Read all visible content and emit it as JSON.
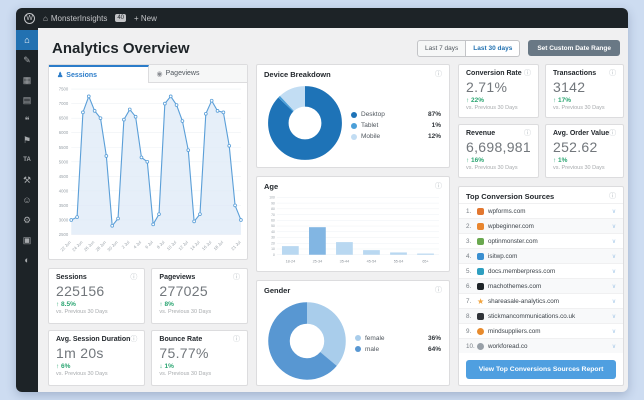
{
  "admin_bar": {
    "wp_logo": "W",
    "home_icon": "⌂",
    "site_name": "MonsterInsights",
    "comment_count": "40",
    "new_label": "+ New"
  },
  "sidebar": {
    "items": [
      {
        "name": "dashboard",
        "glyph": "⌂",
        "active": true
      },
      {
        "name": "posts-pin",
        "glyph": "✎",
        "active": false
      },
      {
        "name": "media",
        "glyph": "▦",
        "active": false
      },
      {
        "name": "pages",
        "glyph": "▤",
        "active": false
      },
      {
        "name": "comments",
        "glyph": "❝",
        "active": false
      },
      {
        "name": "feedback-flag",
        "glyph": "⚑",
        "active": false
      },
      {
        "name": "ta-plugin",
        "glyph": "TA",
        "active": false
      },
      {
        "name": "plugins",
        "glyph": "⚒",
        "active": false
      },
      {
        "name": "users",
        "glyph": "☺",
        "active": false
      },
      {
        "name": "tools",
        "glyph": "⚙",
        "active": false
      },
      {
        "name": "media-2",
        "glyph": "▣",
        "active": false
      },
      {
        "name": "settings",
        "glyph": "◐",
        "active": false
      }
    ]
  },
  "header": {
    "title": "Analytics Overview",
    "range_buttons": [
      {
        "label": "Last 7 days",
        "active": false
      },
      {
        "label": "Last 30 days",
        "active": true
      }
    ],
    "custom_range_label": "Set Custom Date Range"
  },
  "tabs": {
    "sessions": "Sessions",
    "pageviews": "Pageviews"
  },
  "labels": {
    "vs_prev": "vs. Previous 30 Days"
  },
  "chart_data": [
    {
      "type": "area",
      "title": "Sessions over time",
      "x_tick_labels": [
        "22 Jun",
        "24 Jun",
        "26 Jun",
        "28 Jun",
        "30 Jun",
        "2 Jul",
        "4 Jul",
        "6 Jul",
        "8 Jul",
        "10 Jul",
        "12 Jul",
        "14 Jul",
        "16 Jul",
        "18 Jul",
        "21 Jul"
      ],
      "values": [
        3000,
        3100,
        6700,
        7250,
        6750,
        6500,
        5200,
        2800,
        3050,
        6450,
        6800,
        6550,
        5150,
        5000,
        2850,
        3200,
        7000,
        7250,
        6950,
        6400,
        5400,
        2950,
        3200,
        6650,
        7100,
        6750,
        6700,
        5550,
        3500,
        3000
      ],
      "ylim": [
        2500,
        7500
      ],
      "ytick_step": 500,
      "line_color": "#5b9fd8",
      "fill_color": "#ddeaf7",
      "grid": true
    },
    {
      "type": "pie",
      "title": "Device Breakdown",
      "labels": [
        "Desktop",
        "Tablet",
        "Mobile"
      ],
      "values": [
        87,
        1,
        12
      ],
      "value_labels": [
        "87%",
        "1%",
        "12%"
      ],
      "colors": [
        "#1e73b7",
        "#4b9fd8",
        "#c2ddf3"
      ],
      "legend_position": "right"
    },
    {
      "type": "bar",
      "title": "Age",
      "categories": [
        "18-24",
        "25-34",
        "35-44",
        "45-54",
        "55-64",
        "65+"
      ],
      "values": [
        15,
        48,
        22,
        8,
        4,
        2
      ],
      "ylim": [
        0,
        100
      ],
      "ytick_step": 10,
      "bar_color": "#b9d8f1",
      "highlight_index": 1,
      "highlight_color": "#82b6e3",
      "grid": true
    },
    {
      "type": "pie",
      "title": "Gender",
      "labels": [
        "female",
        "male"
      ],
      "values": [
        36,
        64
      ],
      "value_labels": [
        "36%",
        "64%"
      ],
      "colors": [
        "#a9cdeb",
        "#5897d2"
      ],
      "legend_position": "right"
    }
  ],
  "stats_left": [
    {
      "title": "Sessions",
      "value": "225156",
      "delta": "↑ 8.5%"
    },
    {
      "title": "Pageviews",
      "value": "277025",
      "delta": "↑ 8%"
    },
    {
      "title": "Avg. Session Duration",
      "value": "1m 20s",
      "delta": "↑ 6%"
    },
    {
      "title": "Bounce Rate",
      "value": "75.77%",
      "delta": "↓ 1%"
    }
  ],
  "stats_right": [
    {
      "title": "Conversion Rate",
      "value": "2.71%",
      "delta": "↑ 22%"
    },
    {
      "title": "Transactions",
      "value": "3142",
      "delta": "↑ 17%"
    },
    {
      "title": "Revenue",
      "value": "6,698,981",
      "delta": "↑ 16%"
    },
    {
      "title": "Avg. Order Value",
      "value": "252.62",
      "delta": "↑ 1%"
    }
  ],
  "sources": {
    "title": "Top Conversion Sources",
    "button_label": "View Top Conversions Sources Report",
    "chevron": "∨",
    "items": [
      {
        "rank": "1.",
        "domain": "wpforms.com",
        "color": "#e27730",
        "shape": "square"
      },
      {
        "rank": "2.",
        "domain": "wpbeginner.com",
        "color": "#e8852e",
        "shape": "square"
      },
      {
        "rank": "3.",
        "domain": "optinmonster.com",
        "color": "#6aa84f",
        "shape": "square"
      },
      {
        "rank": "4.",
        "domain": "isitwp.com",
        "color": "#3a8fd0",
        "shape": "square"
      },
      {
        "rank": "5.",
        "domain": "docs.memberpress.com",
        "color": "#2e9fc0",
        "shape": "square"
      },
      {
        "rank": "6.",
        "domain": "machothemes.com",
        "color": "#1d2327",
        "shape": "square"
      },
      {
        "rank": "7.",
        "domain": "shareasale-analytics.com",
        "color": "#f2a33c",
        "shape": "star"
      },
      {
        "rank": "8.",
        "domain": "stickmancommunications.co.uk",
        "color": "#2f3338",
        "shape": "square"
      },
      {
        "rank": "9.",
        "domain": "mindsuppliers.com",
        "color": "#e88b2d",
        "shape": "circle"
      },
      {
        "rank": "10.",
        "domain": "workforead.co",
        "color": "#98a0a8",
        "shape": "circle"
      }
    ]
  },
  "icons": {
    "info": "ⓘ",
    "sessions_tab": "♟",
    "pageviews_tab": "◉"
  }
}
